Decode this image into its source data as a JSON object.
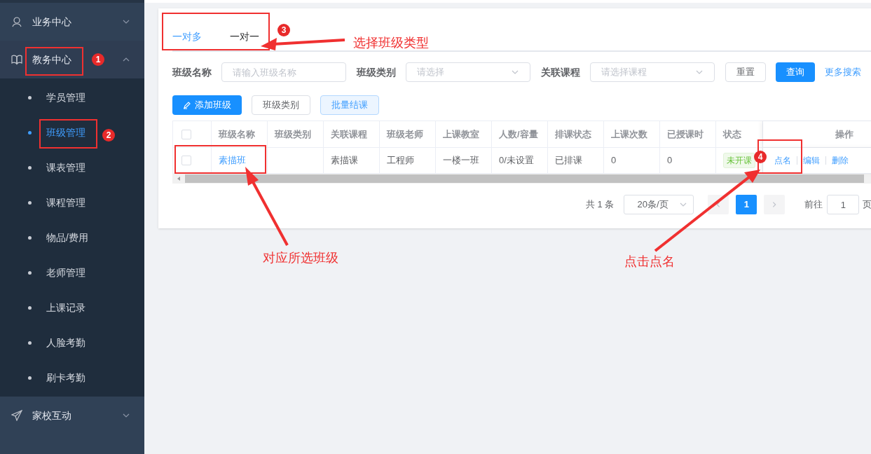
{
  "sidebar": {
    "groups": [
      {
        "label": "业务中心",
        "expanded": false
      },
      {
        "label": "教务中心",
        "expanded": true,
        "children": [
          {
            "label": "学员管理",
            "selected": false
          },
          {
            "label": "班级管理",
            "selected": true
          },
          {
            "label": "课表管理",
            "selected": false
          },
          {
            "label": "课程管理",
            "selected": false
          },
          {
            "label": "物品/费用",
            "selected": false
          },
          {
            "label": "老师管理",
            "selected": false
          },
          {
            "label": "上课记录",
            "selected": false
          },
          {
            "label": "人脸考勤",
            "selected": false
          },
          {
            "label": "刷卡考勤",
            "selected": false
          }
        ]
      },
      {
        "label": "家校互动",
        "expanded": false
      }
    ]
  },
  "tabs": [
    {
      "label": "一对多",
      "selected": true
    },
    {
      "label": "一对一",
      "selected": false
    }
  ],
  "filters": [
    {
      "label": "班级名称",
      "kind": "input",
      "placeholder": "请输入班级名称"
    },
    {
      "label": "班级类别",
      "kind": "select",
      "placeholder": "请选择"
    },
    {
      "label": "关联课程",
      "kind": "select",
      "placeholder": "请选择课程"
    }
  ],
  "filter_buttons": [
    {
      "label": "重置",
      "kind": "default"
    },
    {
      "label": "查询",
      "kind": "primary"
    },
    {
      "label": "更多搜索",
      "kind": "link"
    }
  ],
  "actions": [
    {
      "label": "添加班级",
      "kind": "primary"
    },
    {
      "label": "班级类别",
      "kind": "default"
    },
    {
      "label": "批量结课",
      "kind": "light"
    }
  ],
  "table": {
    "all_checked": false,
    "columns": [
      "班级名称",
      "班级类别",
      "关联课程",
      "班级老师",
      "上课教室",
      "人数/容量",
      "排课状态",
      "上课次数",
      "已授课时",
      "状态",
      "操作"
    ],
    "rows": [
      {
        "checked": false,
        "cells": [
          "素描班",
          "",
          "素描课",
          "工程师",
          "一楼一班",
          "0/未设置",
          "已排课",
          "0",
          "0"
        ],
        "status": "未开课",
        "operations": [
          "点名",
          "编辑",
          "删除"
        ]
      }
    ]
  },
  "pagination": {
    "total": "共 1 条",
    "page_size": "20条/页",
    "pages": [
      {
        "label": "1",
        "selected": true
      }
    ],
    "goto_label": "前往",
    "goto_value": "1",
    "goto_suffix": "页"
  },
  "annotations": {
    "badges": [
      "1",
      "2",
      "3",
      "4"
    ],
    "labels": [
      "选择班级类型",
      "对应所选班级",
      "点击点名"
    ]
  }
}
